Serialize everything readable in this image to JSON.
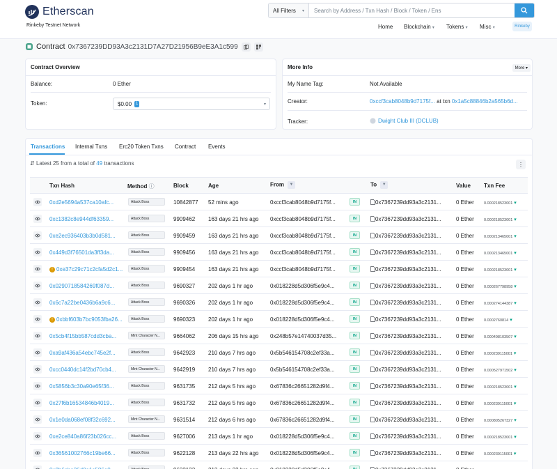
{
  "brand": {
    "name": "Etherscan",
    "network": "Rinkeby Testnet Network"
  },
  "search": {
    "filter": "All Filters",
    "placeholder": "Search by Address / Txn Hash / Block / Token / Ens"
  },
  "nav": {
    "home": "Home",
    "blockchain": "Blockchain",
    "tokens": "Tokens",
    "misc": "Misc",
    "network_badge": "Rinkeby"
  },
  "contract": {
    "label": "Contract",
    "address": "0x7367239DD93A3c2131D7A27D21956B9eE3A1c599"
  },
  "overview": {
    "title": "Contract Overview",
    "balance_label": "Balance:",
    "balance_value": "0 Ether",
    "token_label": "Token:",
    "token_value": "$0.00",
    "token_count": "1"
  },
  "more_info": {
    "title": "More Info",
    "more_button": "More",
    "tag_label": "My Name Tag:",
    "tag_value": "Not Available",
    "creator_label": "Creator:",
    "creator_address": "0xccf3cab8048b9d7175f...",
    "creator_at": "at txn",
    "creator_txn": "0x1a5c88846b2a565b6d...",
    "tracker_label": "Tracker:",
    "tracker_value": "Dwight Club III (DCLUB)"
  },
  "tabs": [
    "Transactions",
    "Internal Txns",
    "Erc20 Token Txns",
    "Contract",
    "Events"
  ],
  "summary": {
    "prefix": "Latest 25 from a total of",
    "count": "49",
    "suffix": "transactions"
  },
  "table": {
    "headers": {
      "hash": "Txn Hash",
      "method": "Method",
      "block": "Block",
      "age": "Age",
      "from": "From",
      "to": "To",
      "value": "Value",
      "fee": "Txn Fee"
    },
    "rows": [
      {
        "hash": "0xd2e5694a537ca10afc...",
        "err": false,
        "method": "Attack Boss",
        "block": "10842877",
        "age": "52 mins ago",
        "from": "0xccf3cab8048b9d7175f...",
        "to": "0x7367239dd93a3c2131...",
        "value": "0 Ether",
        "fee": "0.000218523001"
      },
      {
        "hash": "0xc1382c8e944df63359...",
        "err": false,
        "method": "Attack Boss",
        "block": "9909462",
        "age": "163 days 21 hrs ago",
        "from": "0xccf3cab8048b9d7175f...",
        "to": "0x7367239dd93a3c2131...",
        "value": "0 Ether",
        "fee": "0.000218523001"
      },
      {
        "hash": "0xe2ec936403b3b0d581...",
        "err": false,
        "method": "Attack Boss",
        "block": "9909459",
        "age": "163 days 21 hrs ago",
        "from": "0xccf3cab8048b9d7175f...",
        "to": "0x7367239dd93a3c2131...",
        "value": "0 Ether",
        "fee": "0.000213465001"
      },
      {
        "hash": "0x449d3f76501da3ff3da...",
        "err": false,
        "method": "Attack Boss",
        "block": "9909456",
        "age": "163 days 21 hrs ago",
        "from": "0xccf3cab8048b9d7175f...",
        "to": "0x7367239dd93a3c2131...",
        "value": "0 Ether",
        "fee": "0.000213465001"
      },
      {
        "hash": "0xe37c29c71c2cfa5d2c1...",
        "err": true,
        "method": "Attack Boss",
        "block": "9909454",
        "age": "163 days 21 hrs ago",
        "from": "0xccf3cab8048b9d7175f...",
        "to": "0x7367239dd93a3c2131...",
        "value": "0 Ether",
        "fee": "0.000218523001"
      },
      {
        "hash": "0x0290718584269f087d...",
        "err": false,
        "method": "Attack Boss",
        "block": "9690327",
        "age": "202 days 1 hr ago",
        "from": "0x018228d5d306f5e9c4...",
        "to": "0x7367239dd93a3c2131...",
        "value": "0 Ether",
        "fee": "0.000267798958"
      },
      {
        "hash": "0x6c7a22be0436b6a9c6...",
        "err": false,
        "method": "Attack Boss",
        "block": "9690326",
        "age": "202 days 1 hr ago",
        "from": "0x018228d5d306f5e9c4...",
        "to": "0x7367239dd93a3c2131...",
        "value": "0 Ether",
        "fee": "0.000274144387"
      },
      {
        "hash": "0xbbf603b7bc9053fba26...",
        "err": true,
        "method": "Attack Boss",
        "block": "9690323",
        "age": "202 days 1 hr ago",
        "from": "0x018228d5d306f5e9c4...",
        "to": "0x7367239dd93a3c2131...",
        "value": "0 Ether",
        "fee": "0.0002760814"
      },
      {
        "hash": "0x5cb4f15bb587cdd3cba...",
        "err": false,
        "method": "Mint Character N...",
        "block": "9664062",
        "age": "206 days 15 hrs ago",
        "from": "0x248b57e14740037d35...",
        "to": "0x7367239dd93a3c2131...",
        "value": "0 Ether",
        "fee": "0.000498103507"
      },
      {
        "hash": "0xa9af436a54ebc745e2f...",
        "err": false,
        "method": "Attack Boss",
        "block": "9642923",
        "age": "210 days 7 hrs ago",
        "from": "0x5b546154708c2ef33a...",
        "to": "0x7367239dd93a3c2131...",
        "value": "0 Ether",
        "fee": "0.000239115001"
      },
      {
        "hash": "0xcc0440dc14f2bd70cb4...",
        "err": false,
        "method": "Mint Character N...",
        "block": "9642919",
        "age": "210 days 7 hrs ago",
        "from": "0x5b546154708c2ef33a...",
        "to": "0x7367239dd93a3c2131...",
        "value": "0 Ether",
        "fee": "0.000527971502"
      },
      {
        "hash": "0x5856b3c30a90e65f36...",
        "err": false,
        "method": "Attack Boss",
        "block": "9631735",
        "age": "212 days 5 hrs ago",
        "from": "0x67836c26651282d9f4...",
        "to": "0x7367239dd93a3c2131...",
        "value": "0 Ether",
        "fee": "0.000218523001"
      },
      {
        "hash": "0x27f6b16534846b4019...",
        "err": false,
        "method": "Attack Boss",
        "block": "9631732",
        "age": "212 days 5 hrs ago",
        "from": "0x67836c26651282d9f4...",
        "to": "0x7367239dd93a3c2131...",
        "value": "0 Ether",
        "fee": "0.000239115001"
      },
      {
        "hash": "0x1e0da068ef08f32c692...",
        "err": false,
        "method": "Mint Character N...",
        "block": "9631514",
        "age": "212 days 6 hrs ago",
        "from": "0x67836c26651282d9f4...",
        "to": "0x7367239dd93a3c2131...",
        "value": "0 Ether",
        "fee": "0.000805267327"
      },
      {
        "hash": "0xe2ce840a86f23b026cc...",
        "err": false,
        "method": "Attack Boss",
        "block": "9627006",
        "age": "213 days 1 hr ago",
        "from": "0x018228d5d306f5e9c4...",
        "to": "0x7367239dd93a3c2131...",
        "value": "0 Ether",
        "fee": "0.000218523001"
      },
      {
        "hash": "0x36561002766c19be66...",
        "err": false,
        "method": "Attack Boss",
        "block": "9622128",
        "age": "213 days 22 hrs ago",
        "from": "0x018228d5d306f5e9c4...",
        "to": "0x7367239dd93a3c2131...",
        "value": "0 Ether",
        "fee": "0.000239115001"
      },
      {
        "hash": "0x0b6cba26d0a1c586e0...",
        "err": false,
        "method": "Attack Boss",
        "block": "9622123",
        "age": "213 days 22 hrs ago",
        "from": "0x018228d5d306f5e9c4...",
        "to": "0x7367239dd93a3c2131...",
        "value": "0 Ether",
        "fee": "0.000218523001"
      }
    ]
  }
}
